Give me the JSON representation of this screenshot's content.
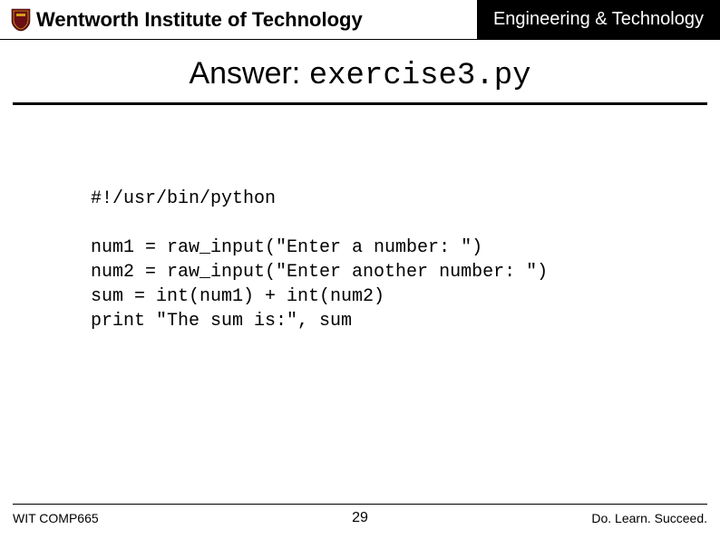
{
  "header": {
    "institute": "Wentworth Institute of Technology",
    "department": "Engineering & Technology"
  },
  "title": {
    "answer_label": "Answer: ",
    "filename": "exercise3.py"
  },
  "code": {
    "line1": "#!/usr/bin/python",
    "blank": "",
    "line2": "num1 = raw_input(\"Enter a number: \")",
    "line3": "num2 = raw_input(\"Enter another number: \")",
    "line4": "sum = int(num1) + int(num2)",
    "line5": "print \"The sum is:\", sum"
  },
  "footer": {
    "course": "WIT COMP665",
    "slide_number": "29",
    "tagline": "Do. Learn. Succeed."
  },
  "colors": {
    "shield_bg": "#6a0f14",
    "shield_accent": "#d4a017"
  }
}
